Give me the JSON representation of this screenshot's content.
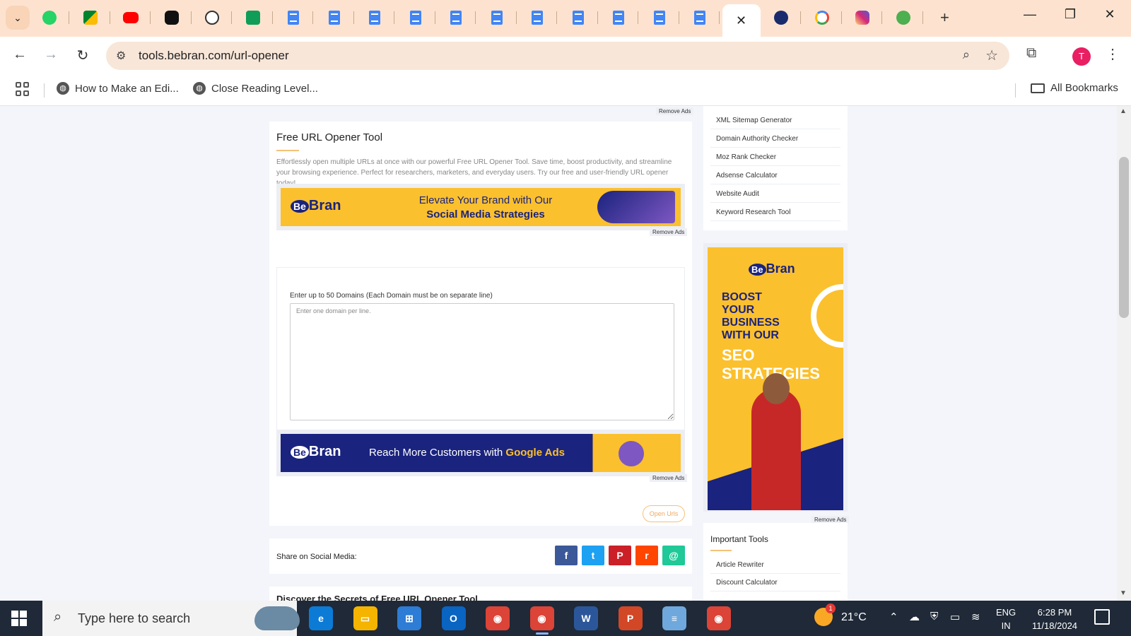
{
  "browser": {
    "tabs": [
      {
        "icon": "whatsapp-icon",
        "cls": "whatsapp"
      },
      {
        "icon": "google-meet-icon",
        "cls": "meet"
      },
      {
        "icon": "youtube-icon",
        "cls": "youtube"
      },
      {
        "icon": "chatgpt-icon",
        "cls": "gpt"
      },
      {
        "icon": "chatgpt-icon",
        "cls": "gpt2"
      },
      {
        "icon": "google-sheets-icon",
        "cls": "sheets"
      },
      {
        "icon": "google-docs-icon",
        "cls": "doc"
      },
      {
        "icon": "google-docs-icon",
        "cls": "doc"
      },
      {
        "icon": "google-docs-icon",
        "cls": "doc"
      },
      {
        "icon": "google-docs-icon",
        "cls": "doc"
      },
      {
        "icon": "google-docs-icon",
        "cls": "doc"
      },
      {
        "icon": "google-docs-icon",
        "cls": "doc"
      },
      {
        "icon": "google-docs-icon",
        "cls": "doc"
      },
      {
        "icon": "google-docs-icon",
        "cls": "doc"
      },
      {
        "icon": "google-docs-icon",
        "cls": "doc"
      },
      {
        "icon": "google-docs-icon",
        "cls": "doc"
      },
      {
        "icon": "google-docs-icon",
        "cls": "doc"
      }
    ],
    "active_tab_icon": "close-icon",
    "after_tabs": [
      {
        "icon": "bebran-icon",
        "cls": "be"
      },
      {
        "icon": "google-icon",
        "cls": "google"
      },
      {
        "icon": "instagram-icon",
        "cls": "insta"
      },
      {
        "icon": "globe-icon",
        "cls": "globe"
      }
    ],
    "url": "tools.bebran.com/url-opener",
    "profile_initial": "T",
    "bookmarks": [
      {
        "label": "How to Make an Edi..."
      },
      {
        "label": "Close Reading Level..."
      }
    ],
    "all_bookmarks": "All Bookmarks"
  },
  "page": {
    "remove_ads": "Remove Ads",
    "tool_title": "Free URL Opener Tool",
    "tool_description": "Effortlessly open multiple URLs at once with our powerful Free URL Opener Tool. Save time, boost productivity, and streamline your browsing experience. Perfect for researchers, marketers, and everyday users. Try our free and user-friendly URL opener today!",
    "ad1": {
      "brand": "Bran",
      "brand_be": "Be",
      "line1": "Elevate Your Brand with Our",
      "line2": "Social Media Strategies"
    },
    "form": {
      "label": "Enter up to 50 Domains (Each Domain must be on separate line)",
      "placeholder": "Enter one domain per line.",
      "value": ""
    },
    "ad2": {
      "brand": "Bran",
      "brand_be": "Be",
      "text": "Reach More Customers with ",
      "highlight": "Google Ads"
    },
    "open_urls_button": "Open Urls",
    "share_label": "Share on Social Media:",
    "share_buttons": [
      {
        "name": "facebook-share-button",
        "glyph": "f",
        "color": "#3b5998"
      },
      {
        "name": "twitter-share-button",
        "glyph": "t",
        "color": "#1da1f2"
      },
      {
        "name": "pinterest-share-button",
        "glyph": "P",
        "color": "#cb2027"
      },
      {
        "name": "reddit-share-button",
        "glyph": "r",
        "color": "#ff4500"
      },
      {
        "name": "email-share-button",
        "glyph": "@",
        "color": "#20c997"
      }
    ],
    "next_heading": "Discover the Secrets of Free URL Opener Tool",
    "sidebar_tools": [
      "XML Sitemap Generator",
      "Domain Authority Checker",
      "Moz Rank Checker",
      "Adsense Calculator",
      "Website Audit",
      "Keyword Research Tool"
    ],
    "side_ad": {
      "brand": "Bran",
      "brand_be": "Be",
      "line1": "BOOST",
      "line2": "YOUR",
      "line3": "BUSINESS",
      "line4": "WITH OUR",
      "line5": "SEO",
      "line6": "STRATEGIES"
    },
    "important_tools_title": "Important Tools",
    "important_tools": [
      "Article Rewriter",
      "Discount Calculator"
    ]
  },
  "taskbar": {
    "search_placeholder": "Type here to search",
    "apps": [
      {
        "name": "edge-app-icon",
        "color": "#0c7bd6",
        "glyph": "e"
      },
      {
        "name": "file-explorer-app-icon",
        "color": "#f4b400",
        "glyph": "▭"
      },
      {
        "name": "microsoft-store-app-icon",
        "color": "#2d7cd6",
        "glyph": "⊞"
      },
      {
        "name": "outlook-app-icon",
        "color": "#0a64c2",
        "glyph": "O"
      },
      {
        "name": "chrome-app-icon",
        "color": "#db4437",
        "glyph": "◉"
      },
      {
        "name": "chrome-profile-app-icon",
        "color": "#db4437",
        "glyph": "◉"
      },
      {
        "name": "word-app-icon",
        "color": "#2b579a",
        "glyph": "W"
      },
      {
        "name": "powerpoint-app-icon",
        "color": "#d24726",
        "glyph": "P"
      },
      {
        "name": "notepad-app-icon",
        "color": "#6fa8dc",
        "glyph": "≡"
      },
      {
        "name": "chrome-profile2-app-icon",
        "color": "#db4437",
        "glyph": "◉"
      }
    ],
    "weather_badge": "1",
    "temperature": "21°C",
    "lang_top": "ENG",
    "lang_bottom": "IN",
    "time": "6:28 PM",
    "date": "11/18/2024"
  }
}
